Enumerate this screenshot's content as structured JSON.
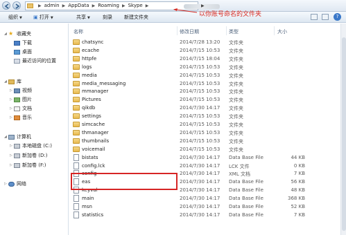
{
  "address": {
    "crumbs": [
      "admin",
      "AppData",
      "Roaming",
      "Skype"
    ],
    "separator": "▶"
  },
  "toolbar": {
    "organize": "组织",
    "open": "打开",
    "share": "共享",
    "burn": "刻录",
    "new_folder": "新建文件夹",
    "help": "?"
  },
  "annotation": {
    "text": "以你账号命名的文件夹",
    "color": "#d8281f"
  },
  "nav": {
    "favorites": "收藏夹",
    "download": "下载",
    "desktop": "桌面",
    "recent": "最近访问的位置",
    "libraries": "库",
    "video": "视频",
    "pictures": "图片",
    "documents": "文档",
    "music": "音乐",
    "computer": "计算机",
    "disk_c": "本地磁盘 (C:)",
    "disk_d": "新加卷 (D:)",
    "disk_f": "新加卷 (F:)",
    "network": "网络"
  },
  "columns": {
    "name": "名称",
    "date": "修改日期",
    "type": "类型",
    "size": "大小"
  },
  "files": [
    {
      "name": "chatsync",
      "date": "2014/7/28 13:20",
      "type": "文件夹",
      "size": "",
      "kind": "folder"
    },
    {
      "name": "ecache",
      "date": "2014/7/15 10:53",
      "type": "文件夹",
      "size": "",
      "kind": "folder"
    },
    {
      "name": "httpfe",
      "date": "2014/7/15 18:04",
      "type": "文件夹",
      "size": "",
      "kind": "folder"
    },
    {
      "name": "logs",
      "date": "2014/7/15 10:53",
      "type": "文件夹",
      "size": "",
      "kind": "folder"
    },
    {
      "name": "media",
      "date": "2014/7/15 10:53",
      "type": "文件夹",
      "size": "",
      "kind": "folder"
    },
    {
      "name": "media_messaging",
      "date": "2014/7/15 10:53",
      "type": "文件夹",
      "size": "",
      "kind": "folder"
    },
    {
      "name": "mmanager",
      "date": "2014/7/15 10:53",
      "type": "文件夹",
      "size": "",
      "kind": "folder"
    },
    {
      "name": "Pictures",
      "date": "2014/7/15 10:53",
      "type": "文件夹",
      "size": "",
      "kind": "folder"
    },
    {
      "name": "qikdb",
      "date": "2014/7/30 14:17",
      "type": "文件夹",
      "size": "",
      "kind": "folder"
    },
    {
      "name": "settings",
      "date": "2014/7/15 10:53",
      "type": "文件夹",
      "size": "",
      "kind": "folder"
    },
    {
      "name": "simcache",
      "date": "2014/7/15 10:53",
      "type": "文件夹",
      "size": "",
      "kind": "folder"
    },
    {
      "name": "thmanager",
      "date": "2014/7/15 10:53",
      "type": "文件夹",
      "size": "",
      "kind": "folder"
    },
    {
      "name": "thumbnails",
      "date": "2014/7/15 10:53",
      "type": "文件夹",
      "size": "",
      "kind": "folder"
    },
    {
      "name": "voicemail",
      "date": "2014/7/15 10:53",
      "type": "文件夹",
      "size": "",
      "kind": "folder"
    },
    {
      "name": "bistats",
      "date": "2014/7/30 14:17",
      "type": "Data Base File",
      "size": "44 KB",
      "kind": "file"
    },
    {
      "name": "config.lck",
      "date": "2014/7/30 14:17",
      "type": "LCK 文件",
      "size": "0 KB",
      "kind": "file"
    },
    {
      "name": "config",
      "date": "2014/7/30 14:17",
      "type": "XML 文档",
      "size": "7 KB",
      "kind": "file"
    },
    {
      "name": "eas",
      "date": "2014/7/30 14:17",
      "type": "Data Base File",
      "size": "56 KB",
      "kind": "file"
    },
    {
      "name": "keyval",
      "date": "2014/7/30 14:17",
      "type": "Data Base File",
      "size": "48 KB",
      "kind": "file"
    },
    {
      "name": "main",
      "date": "2014/7/30 14:17",
      "type": "Data Base File",
      "size": "368 KB",
      "kind": "file"
    },
    {
      "name": "msn",
      "date": "2014/7/30 14:17",
      "type": "Data Base File",
      "size": "52 KB",
      "kind": "file"
    },
    {
      "name": "statistics",
      "date": "2014/7/30 14:17",
      "type": "Data Base File",
      "size": "7 KB",
      "kind": "file"
    }
  ]
}
